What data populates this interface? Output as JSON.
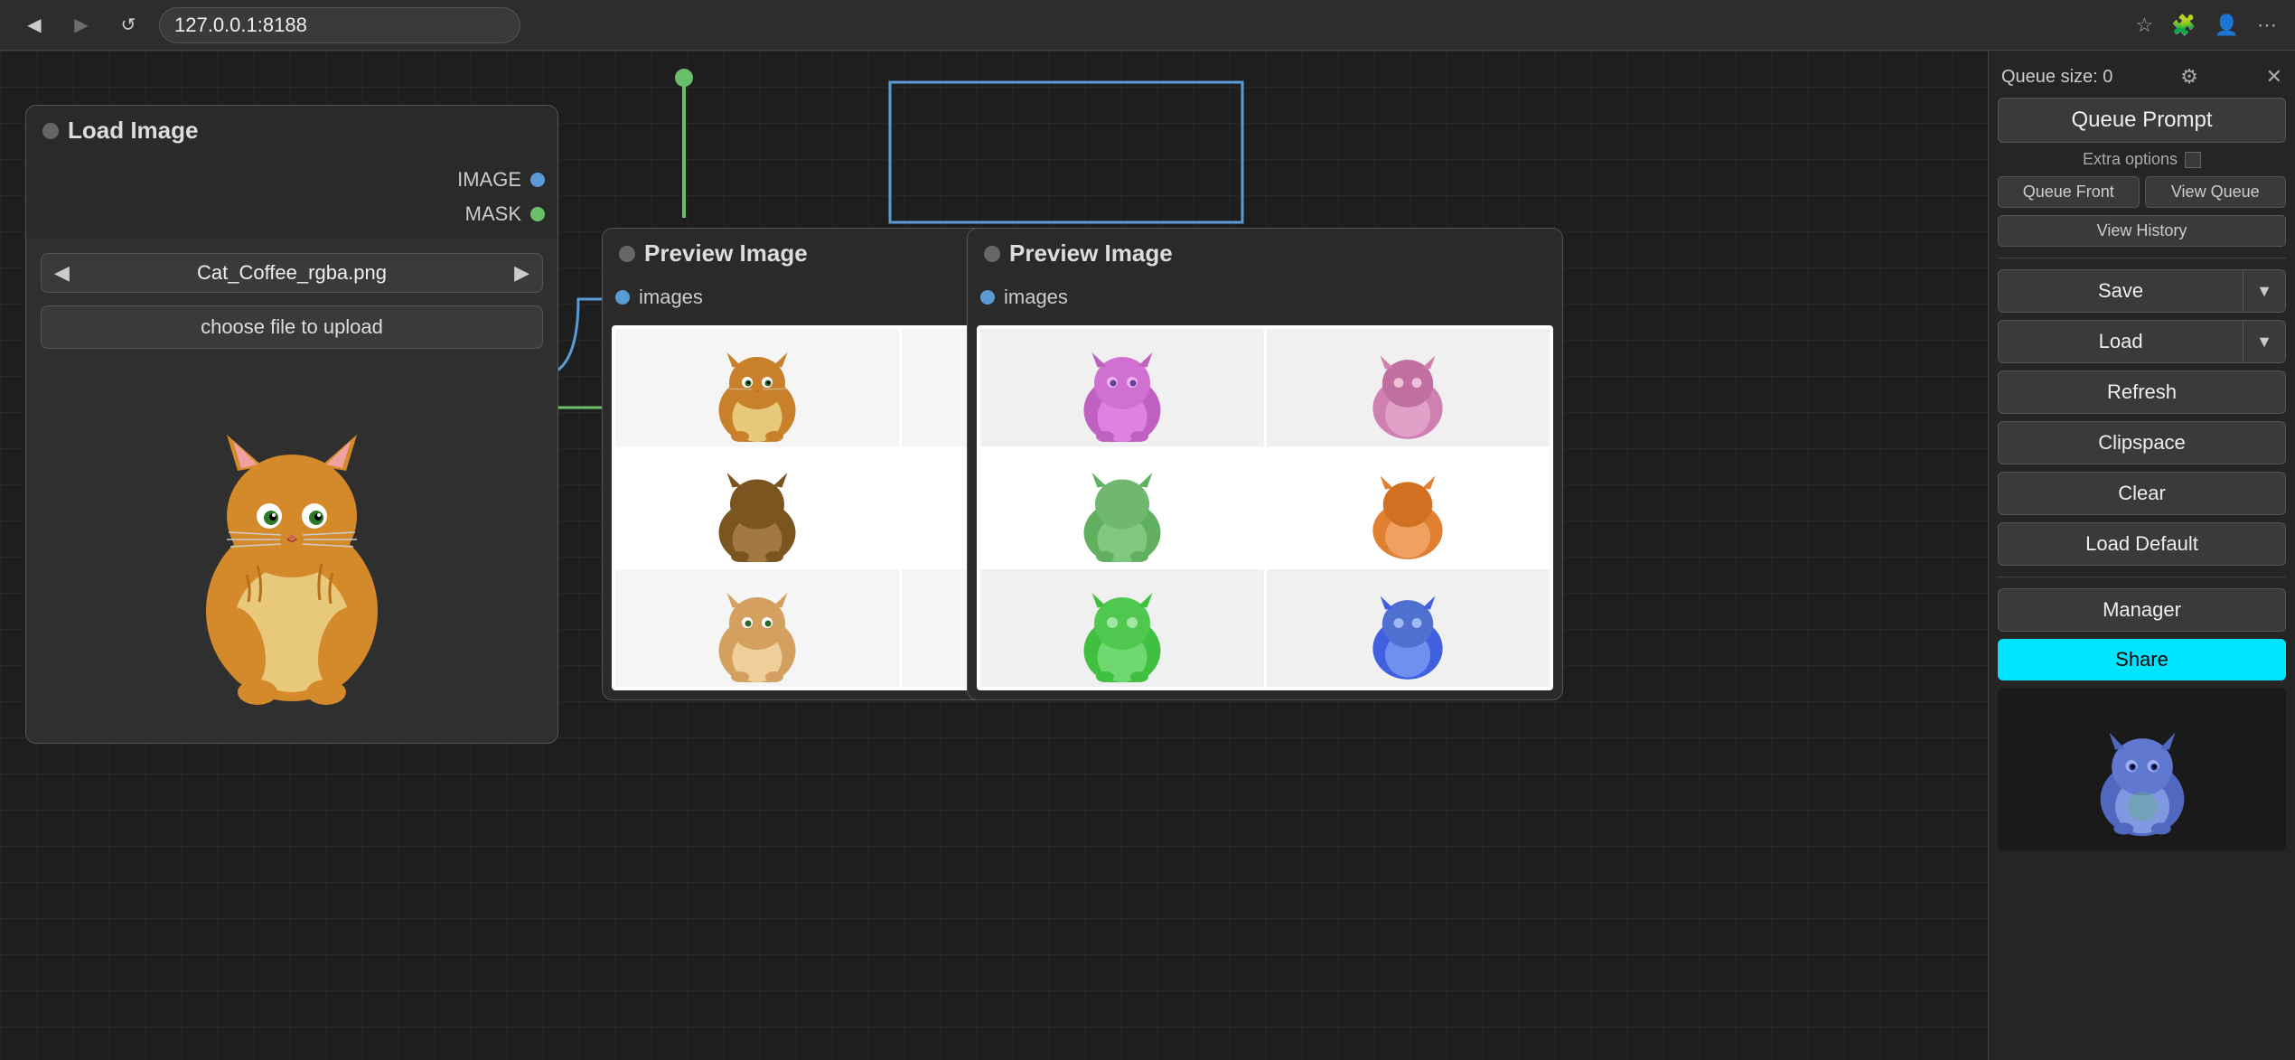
{
  "browser": {
    "url": "127.0.0.1:8188",
    "back_label": "◀",
    "refresh_label": "↺"
  },
  "sidebar": {
    "queue_size_label": "Queue size: 0",
    "queue_prompt_label": "Queue Prompt",
    "extra_options_label": "Extra options",
    "queue_front_label": "Queue Front",
    "view_queue_label": "View Queue",
    "view_history_label": "View History",
    "save_label": "Save",
    "load_label": "Load",
    "refresh_label": "Refresh",
    "clipspace_label": "Clipspace",
    "clear_label": "Clear",
    "load_default_label": "Load Default",
    "manager_label": "Manager",
    "share_label": "Share"
  },
  "load_image_node": {
    "title": "Load Image",
    "image_port_label": "IMAGE",
    "mask_port_label": "MASK",
    "file_name": "Cat_Coffee_rgba.png",
    "upload_label": "choose file to upload"
  },
  "preview_node_1": {
    "title": "Preview Image",
    "images_port_label": "images"
  },
  "preview_node_2": {
    "title": "Preview Image",
    "images_port_label": "images"
  }
}
